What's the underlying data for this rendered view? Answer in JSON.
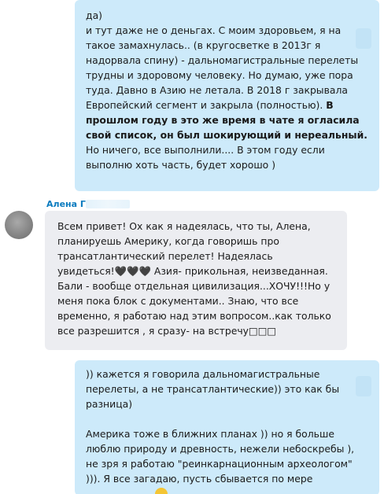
{
  "messages": [
    {
      "direction": "outgoing",
      "lines": [
        {
          "text": "да)"
        },
        {
          "text": "и тут даже не о деньгах. С моим здоровьем, я на"
        },
        {
          "text": "такое замахнулась.. (в кругосветке в 2013г я"
        },
        {
          "text": "надорвала спину) -  дальномагистральные перелеты"
        },
        {
          "text": "трудны и здоровому человеку. Но думаю, уже пора"
        },
        {
          "text": "туда. Давно в Азию не летала. В 2018 г закрывала"
        },
        {
          "text": "Европейский сегмент и закрыла (полностью).",
          "bold_tail": "В"
        },
        {
          "text": "прошлом году в это же время в чате я огласила",
          "bold": true
        },
        {
          "text": "свой список, он был шокирующий и нереальный.",
          "bold": true
        },
        {
          "text": "Но ничего, все выполнили.... В этом году если"
        },
        {
          "text": "выполню хоть часть, будет хорошо )"
        }
      ]
    },
    {
      "direction": "incoming",
      "sender": "Алена Ге",
      "lines": [
        {
          "text": "Всем привет!  Ох как я надеялась, что ты, Алена,"
        },
        {
          "text": "планируешь Америку, когда говоришь про"
        },
        {
          "text": "трансатлантический перелет! Надеялась"
        },
        {
          "text": "увидеться!🖤🖤🖤  Азия- прикольная, неизведанная."
        },
        {
          "text": "Бали - вообще отдельная цивилизация...ХОЧУ!!!Но у"
        },
        {
          "text": "меня пока блок с документами.. Знаю, что все"
        },
        {
          "text": "временно, я работаю над этим вопросом..как только"
        },
        {
          "text": "все разрешится , я сразу- на встречу□□□"
        }
      ]
    },
    {
      "direction": "outgoing",
      "lines": [
        {
          "text": ")) кажется я говорила дальномагистральные"
        },
        {
          "text": "перелеты, а не трансатлантические)) это как бы"
        },
        {
          "text": "разница)"
        },
        {
          "text": ""
        },
        {
          "text": "Америка тоже в ближних планах )) но я больше"
        },
        {
          "text": "люблю природу и древность, нежели небоскребы ),"
        },
        {
          "text": "не зря я работаю \"реинкарнационным археологом\""
        },
        {
          "text": "))). Я все загадаю, пусть сбывается по мере"
        }
      ]
    }
  ],
  "colors": {
    "outgoing_bubble": "#cdeafa",
    "incoming_bubble": "#ecedf1",
    "sender_name": "#0a7bbf"
  }
}
